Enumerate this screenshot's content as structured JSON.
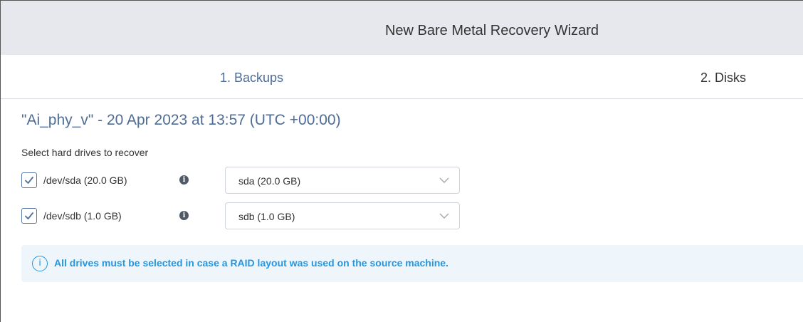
{
  "header": {
    "title": "New Bare Metal Recovery Wizard"
  },
  "steps": [
    {
      "label": "1. Backups"
    },
    {
      "label": "2. Disks"
    }
  ],
  "backup": {
    "title": "\"Ai_phy_v\" - 20 Apr 2023 at 13:57 (UTC +00:00)"
  },
  "section": {
    "label": "Select hard drives to recover"
  },
  "drives": [
    {
      "label": "/dev/sda (20.0 GB)",
      "checked": true,
      "target": "sda (20.0 GB)",
      "info_icon": "info-icon"
    },
    {
      "label": "/dev/sdb (1.0 GB)",
      "checked": true,
      "target": "sdb (1.0 GB)",
      "info_icon": "info-icon"
    }
  ],
  "notice": {
    "text": "All drives must be selected in case a RAID layout was used on the source machine.",
    "icon": "info-circle-icon",
    "color": "#2596e0"
  },
  "colors": {
    "accent": "#4e6d96",
    "header_bg": "#e6e8ed"
  }
}
